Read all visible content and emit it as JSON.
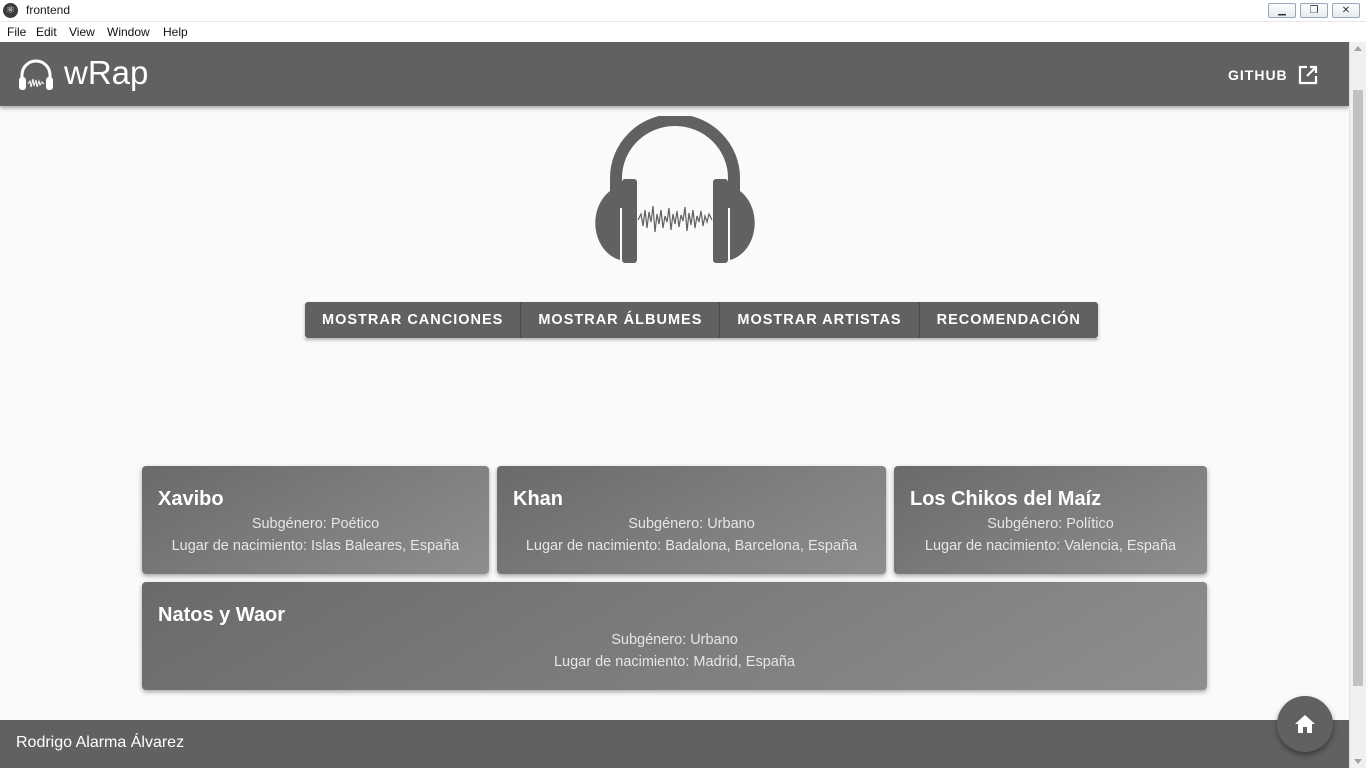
{
  "window": {
    "title": "frontend",
    "menu": [
      "File",
      "Edit",
      "View",
      "Window",
      "Help"
    ]
  },
  "appbar": {
    "brand": "wRap",
    "github_label": "GITHUB"
  },
  "actions": {
    "songs": "MOSTRAR CANCIONES",
    "albums": "MOSTRAR ÁLBUMES",
    "artists": "MOSTRAR ARTISTAS",
    "recommendation": "RECOMENDACIÓN"
  },
  "artists": [
    {
      "name": "Xavibo",
      "subgenre": "Subgénero: Poético",
      "birthplace": "Lugar de nacimiento: Islas Baleares, España"
    },
    {
      "name": "Khan",
      "subgenre": "Subgénero: Urbano",
      "birthplace": "Lugar de nacimiento: Badalona, Barcelona, España"
    },
    {
      "name": "Los Chikos del Maíz",
      "subgenre": "Subgénero: Político",
      "birthplace": "Lugar de nacimiento: Valencia, España"
    },
    {
      "name": "Natos y Waor",
      "subgenre": "Subgénero: Urbano",
      "birthplace": "Lugar de nacimiento: Madrid, España"
    }
  ],
  "footer": {
    "author": "Rodrigo Alarma Álvarez"
  },
  "colors": {
    "primary": "#616161",
    "background": "#fafafa"
  },
  "icons": {
    "logo": "headphones-icon",
    "github": "open-in-new-icon",
    "fab": "home-icon"
  }
}
